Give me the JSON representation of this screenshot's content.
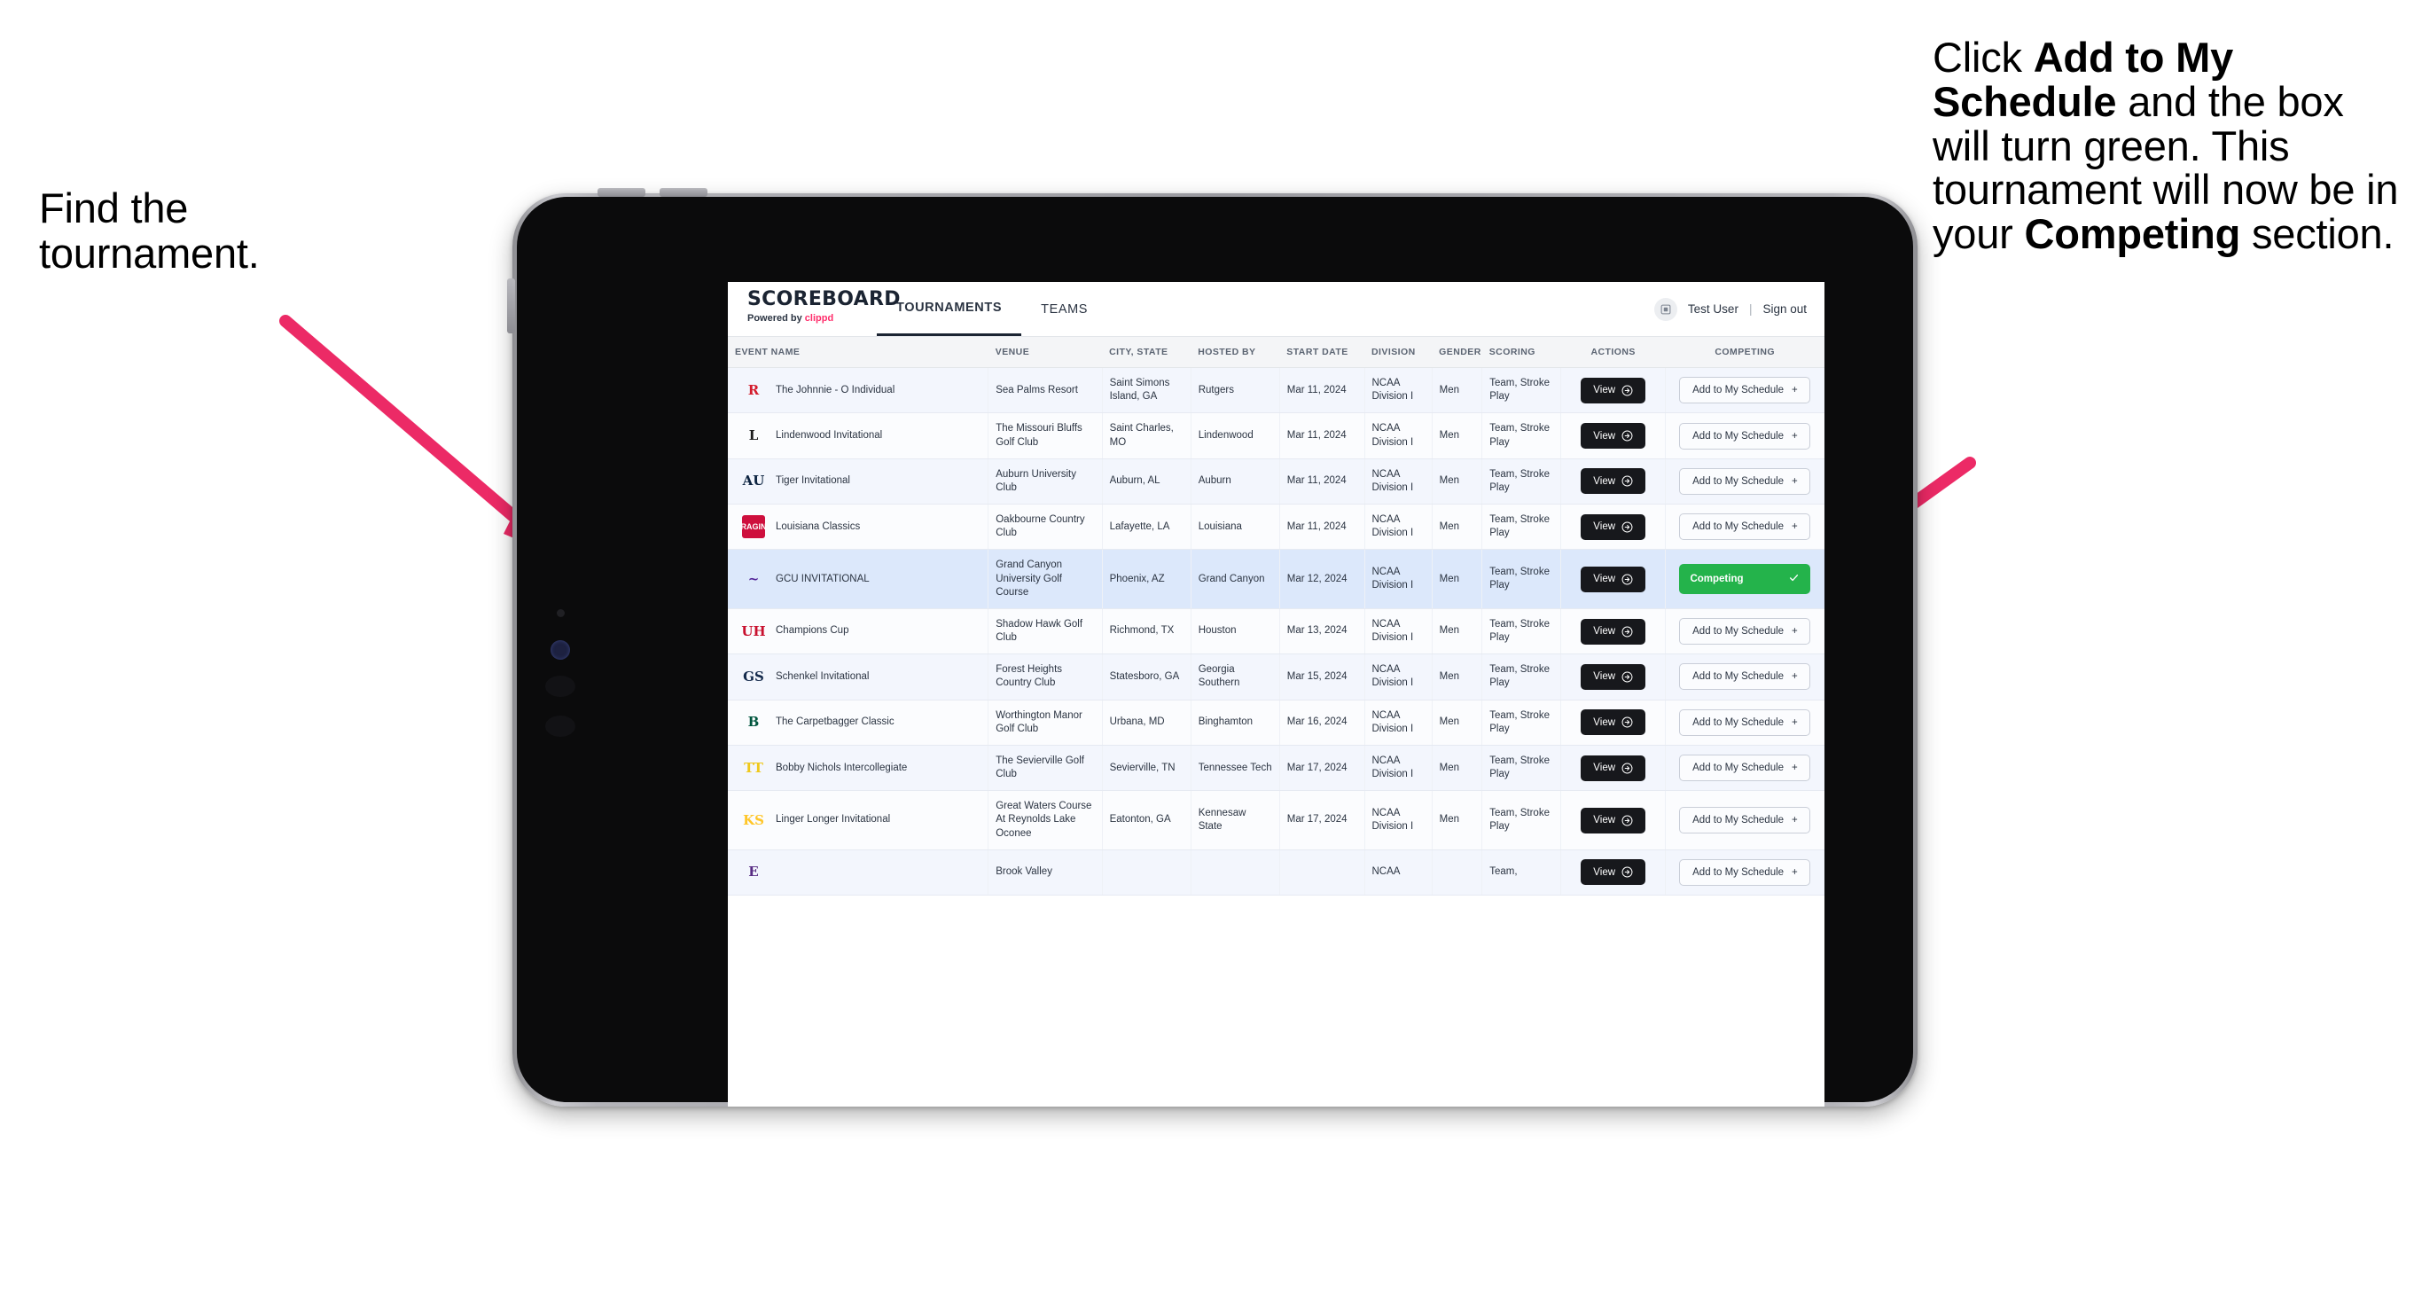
{
  "annotations": {
    "left": "Find the tournament.",
    "right_parts": [
      {
        "text": "Click ",
        "bold": false
      },
      {
        "text": "Add to My Schedule",
        "bold": true
      },
      {
        "text": " and the box will turn green. This tournament will now be in your ",
        "bold": false
      },
      {
        "text": "Competing",
        "bold": true
      },
      {
        "text": " section.",
        "bold": false
      }
    ],
    "arrow_color": "#ec2a66"
  },
  "app": {
    "brand": {
      "title": "SCOREBOARD",
      "powered_prefix": "Powered by ",
      "powered_name": "clippd"
    },
    "nav": [
      {
        "label": "TOURNAMENTS",
        "active": true
      },
      {
        "label": "TEAMS",
        "active": false
      }
    ],
    "account": {
      "avatar_icon": "user-badge-icon",
      "user": "Test User",
      "separator": "|",
      "signout": "Sign out"
    },
    "table": {
      "columns": [
        "EVENT NAME",
        "VENUE",
        "CITY, STATE",
        "HOSTED BY",
        "START DATE",
        "DIVISION",
        "GENDER",
        "SCORING",
        "ACTIONS",
        "COMPETING"
      ],
      "action_label": "View",
      "add_label": "Add to My Schedule",
      "add_icon": "plus-icon",
      "competing_label": "Competing",
      "competing_icon": "check-icon",
      "competing_color": "#24b34b",
      "rows": [
        {
          "logo": {
            "text": "R",
            "color": "#d41b2c",
            "bg": "transparent"
          },
          "event": "The Johnnie - O Individual",
          "venue": "Sea Palms Resort",
          "city": "Saint Simons Island, GA",
          "host": "Rutgers",
          "date": "Mar 11, 2024",
          "division": "NCAA Division I",
          "gender": "Men",
          "scoring": "Team, Stroke Play",
          "competing": false
        },
        {
          "logo": {
            "text": "L",
            "color": "#1c1c1c",
            "bg": "transparent"
          },
          "event": "Lindenwood Invitational",
          "venue": "The Missouri Bluffs Golf Club",
          "city": "Saint Charles, MO",
          "host": "Lindenwood",
          "date": "Mar 11, 2024",
          "division": "NCAA Division I",
          "gender": "Men",
          "scoring": "Team, Stroke Play",
          "competing": false
        },
        {
          "logo": {
            "text": "AU",
            "color": "#0c2340",
            "bg": "transparent"
          },
          "event": "Tiger Invitational",
          "venue": "Auburn University Club",
          "city": "Auburn, AL",
          "host": "Auburn",
          "date": "Mar 11, 2024",
          "division": "NCAA Division I",
          "gender": "Men",
          "scoring": "Team, Stroke Play",
          "competing": false
        },
        {
          "logo": {
            "text": "RAGIN",
            "color": "#ffffff",
            "bg": "#ce0f3d"
          },
          "event": "Louisiana Classics",
          "venue": "Oakbourne Country Club",
          "city": "Lafayette, LA",
          "host": "Louisiana",
          "date": "Mar 11, 2024",
          "division": "NCAA Division I",
          "gender": "Men",
          "scoring": "Team, Stroke Play",
          "competing": false
        },
        {
          "logo": {
            "text": "~",
            "color": "#522398",
            "bg": "transparent"
          },
          "event": "GCU INVITATIONAL",
          "venue": "Grand Canyon University Golf Course",
          "city": "Phoenix, AZ",
          "host": "Grand Canyon",
          "date": "Mar 12, 2024",
          "division": "NCAA Division I",
          "gender": "Men",
          "scoring": "Team, Stroke Play",
          "competing": true
        },
        {
          "logo": {
            "text": "UH",
            "color": "#c8102e",
            "bg": "transparent"
          },
          "event": "Champions Cup",
          "venue": "Shadow Hawk Golf Club",
          "city": "Richmond, TX",
          "host": "Houston",
          "date": "Mar 13, 2024",
          "division": "NCAA Division I",
          "gender": "Men",
          "scoring": "Team, Stroke Play",
          "competing": false
        },
        {
          "logo": {
            "text": "GS",
            "color": "#13294b",
            "bg": "transparent"
          },
          "event": "Schenkel Invitational",
          "venue": "Forest Heights Country Club",
          "city": "Statesboro, GA",
          "host": "Georgia Southern",
          "date": "Mar 15, 2024",
          "division": "NCAA Division I",
          "gender": "Men",
          "scoring": "Team, Stroke Play",
          "competing": false
        },
        {
          "logo": {
            "text": "B",
            "color": "#00553e",
            "bg": "transparent"
          },
          "event": "The Carpetbagger Classic",
          "venue": "Worthington Manor Golf Club",
          "city": "Urbana, MD",
          "host": "Binghamton",
          "date": "Mar 16, 2024",
          "division": "NCAA Division I",
          "gender": "Men",
          "scoring": "Team, Stroke Play",
          "competing": false
        },
        {
          "logo": {
            "text": "TT",
            "color": "#efc81a",
            "bg": "transparent"
          },
          "event": "Bobby Nichols Intercollegiate",
          "venue": "The Sevierville Golf Club",
          "city": "Sevierville, TN",
          "host": "Tennessee Tech",
          "date": "Mar 17, 2024",
          "division": "NCAA Division I",
          "gender": "Men",
          "scoring": "Team, Stroke Play",
          "competing": false
        },
        {
          "logo": {
            "text": "KS",
            "color": "#ffc629",
            "bg": "transparent"
          },
          "event": "Linger Longer Invitational",
          "venue": "Great Waters Course At Reynolds Lake Oconee",
          "city": "Eatonton, GA",
          "host": "Kennesaw State",
          "date": "Mar 17, 2024",
          "division": "NCAA Division I",
          "gender": "Men",
          "scoring": "Team, Stroke Play",
          "competing": false
        },
        {
          "logo": {
            "text": "E",
            "color": "#582c83",
            "bg": "transparent"
          },
          "event": "",
          "venue": "Brook Valley",
          "city": "",
          "host": "",
          "date": "",
          "division": "NCAA",
          "gender": "",
          "scoring": "Team,",
          "competing": false
        }
      ]
    }
  }
}
